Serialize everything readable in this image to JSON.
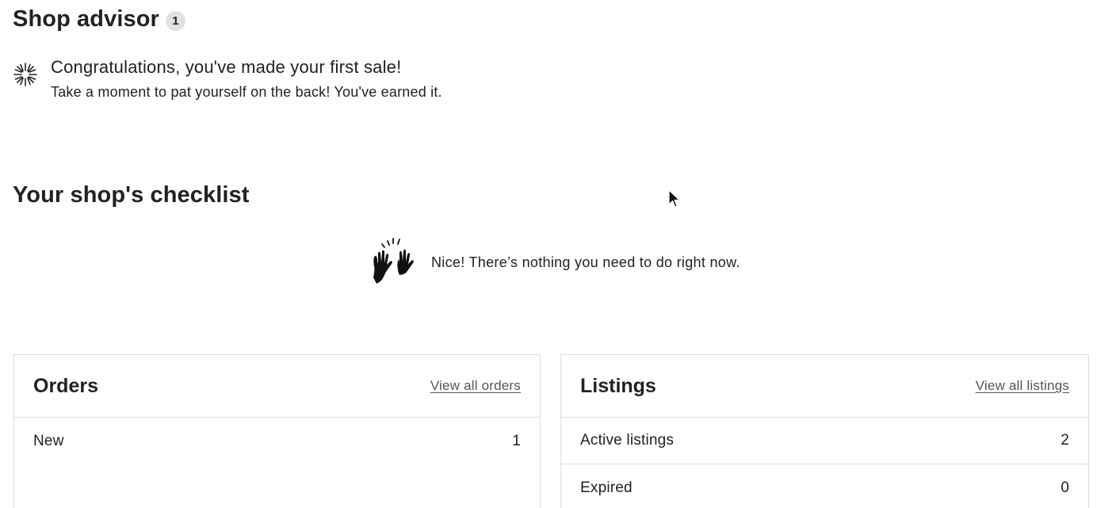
{
  "shop_advisor": {
    "title": "Shop advisor",
    "badge_count": "1",
    "item": {
      "icon": "burst-icon",
      "title": "Congratulations, you've made your first sale!",
      "subtitle": "Take a moment to pat yourself on the back! You've earned it."
    }
  },
  "checklist": {
    "title": "Your shop's checklist",
    "empty_icon": "raised-hands-icon",
    "empty_message": "Nice! There’s nothing you need to do right now."
  },
  "orders": {
    "title": "Orders",
    "link": "View all orders",
    "rows": [
      {
        "label": "New",
        "value": "1"
      }
    ]
  },
  "listings": {
    "title": "Listings",
    "link": "View all listings",
    "rows": [
      {
        "label": "Active listings",
        "value": "2"
      },
      {
        "label": "Expired",
        "value": "0"
      }
    ]
  }
}
